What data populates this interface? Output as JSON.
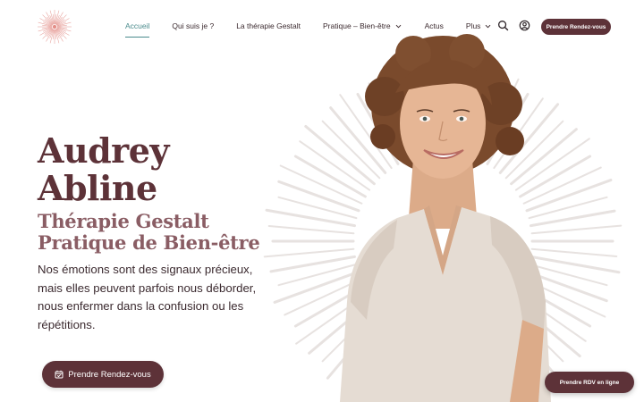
{
  "header": {
    "logo_icon": "sunburst-logo-icon",
    "nav": [
      {
        "label": "Accueil",
        "active": true
      },
      {
        "label": "Qui suis je ?"
      },
      {
        "label": "La thérapie Gestalt"
      },
      {
        "label": "Pratique – Bien-être",
        "dropdown": true
      },
      {
        "label": "Actus"
      },
      {
        "label": "Plus",
        "dropdown": true
      }
    ],
    "search_icon": "search-icon",
    "account_icon": "user-circle-icon",
    "cta_label": "Prendre Rendez-vous"
  },
  "hero": {
    "name_line1": "Audrey",
    "name_line2": "Abline",
    "subtitle_line1": "Thérapie Gestalt",
    "subtitle_line2": "Pratique de Bien-être",
    "description": "Nos émotions sont des signaux précieux, mais elles peuvent parfois nous déborder, nous enfermer dans la confusion ou les répétitions.",
    "cta_label": "Prendre Rendez-vous",
    "cta_icon": "calendar-check-icon",
    "portrait": "portrait-photo"
  },
  "floating_button": {
    "label": "Prendre RDV en ligne"
  },
  "colors": {
    "brand": "#5d3238",
    "subtitle": "#8a5d64",
    "active_nav": "#4a8b8c",
    "text": "#3b2a2f",
    "rays": "#e7e2e0"
  }
}
